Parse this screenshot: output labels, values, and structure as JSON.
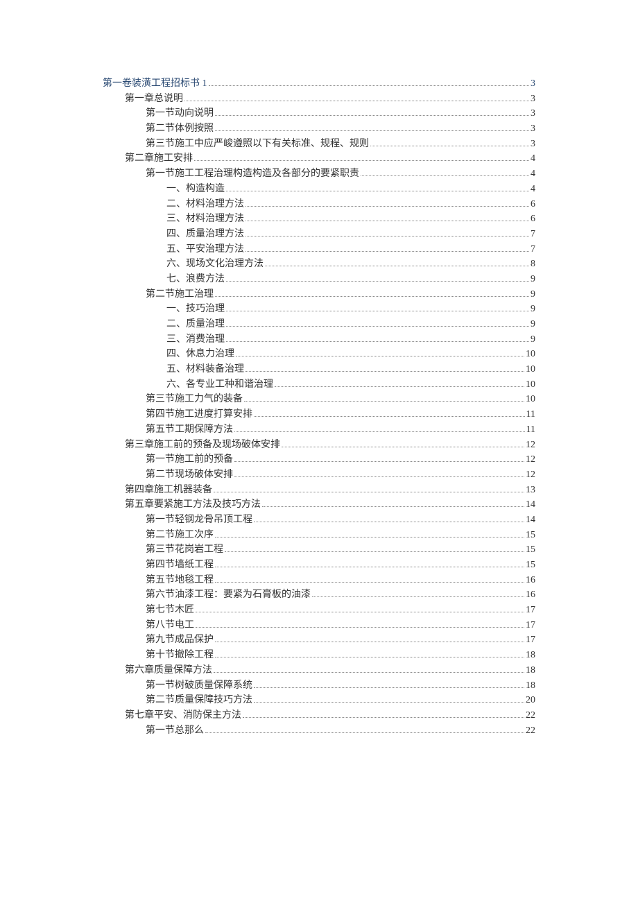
{
  "toc": [
    {
      "level": 0,
      "label": "第一卷装潢工程招标书 1",
      "page": "3"
    },
    {
      "level": 1,
      "label": "第一章总说明",
      "page": "3"
    },
    {
      "level": 2,
      "label": "第一节动向说明",
      "page": "3"
    },
    {
      "level": 2,
      "label": "第二节体例按照",
      "page": "3"
    },
    {
      "level": 2,
      "label": "第三节施工中应严峻遵照以下有关标准、规程、规则",
      "page": "3"
    },
    {
      "level": 1,
      "label": "第二章施工安排",
      "page": "4"
    },
    {
      "level": 2,
      "label": "第一节施工工程治理构造构造及各部分的要紧职责",
      "page": "4"
    },
    {
      "level": 3,
      "label": "一、构造构造",
      "page": "4"
    },
    {
      "level": 3,
      "label": "二、材料治理方法",
      "page": "6"
    },
    {
      "level": 3,
      "label": "三、材料治理方法",
      "page": "6"
    },
    {
      "level": 3,
      "label": "四、质量治理方法",
      "page": "7"
    },
    {
      "level": 3,
      "label": "五、平安治理方法",
      "page": "7"
    },
    {
      "level": 3,
      "label": "六、现场文化治理方法",
      "page": "8"
    },
    {
      "level": 3,
      "label": "七、浪费方法",
      "page": "9"
    },
    {
      "level": 2,
      "label": "第二节施工治理",
      "page": "9"
    },
    {
      "level": 3,
      "label": "一、技巧治理",
      "page": "9"
    },
    {
      "level": 3,
      "label": "二、质量治理",
      "page": "9"
    },
    {
      "level": 3,
      "label": "三、消费治理",
      "page": "9"
    },
    {
      "level": 3,
      "label": "四、休息力治理",
      "page": "10"
    },
    {
      "level": 3,
      "label": "五、材料装备治理",
      "page": "10"
    },
    {
      "level": 3,
      "label": "六、各专业工种和谐治理",
      "page": "10"
    },
    {
      "level": 2,
      "label": "第三节施工力气的装备",
      "page": "10"
    },
    {
      "level": 2,
      "label": "第四节施工进度打算安排",
      "page": "11"
    },
    {
      "level": 2,
      "label": "第五节工期保障方法",
      "page": "11"
    },
    {
      "level": 1,
      "label": "第三章施工前的预备及现场破体安排",
      "page": "12"
    },
    {
      "level": 2,
      "label": "第一节施工前的预备",
      "page": "12"
    },
    {
      "level": 2,
      "label": "第二节现场破体安排",
      "page": "12"
    },
    {
      "level": 1,
      "label": "第四章施工机器装备",
      "page": "13"
    },
    {
      "level": 1,
      "label": "第五章要紧施工方法及技巧方法",
      "page": "14"
    },
    {
      "level": 2,
      "label": "第一节轻钢龙骨吊顶工程",
      "page": "14"
    },
    {
      "level": 2,
      "label": "第二节施工次序",
      "page": "15"
    },
    {
      "level": 2,
      "label": "第三节花岗岩工程",
      "page": "15"
    },
    {
      "level": 2,
      "label": "第四节墙纸工程",
      "page": "15"
    },
    {
      "level": 2,
      "label": "第五节地毯工程",
      "page": "16"
    },
    {
      "level": 2,
      "label": "第六节油漆工程：要紧为石膏板的油漆",
      "page": "16"
    },
    {
      "level": 2,
      "label": "第七节木匠",
      "page": "17"
    },
    {
      "level": 2,
      "label": "第八节电工",
      "page": "17"
    },
    {
      "level": 2,
      "label": "第九节成品保护",
      "page": "17"
    },
    {
      "level": 2,
      "label": "第十节撤除工程",
      "page": "18"
    },
    {
      "level": 1,
      "label": "第六章质量保障方法",
      "page": "18"
    },
    {
      "level": 2,
      "label": "第一节树破质量保障系统",
      "page": "18"
    },
    {
      "level": 2,
      "label": "第二节质量保障技巧方法",
      "page": "20"
    },
    {
      "level": 1,
      "label": "第七章平安、消防保主方法",
      "page": "22"
    },
    {
      "level": 2,
      "label": "第一节总那么",
      "page": "22"
    }
  ]
}
